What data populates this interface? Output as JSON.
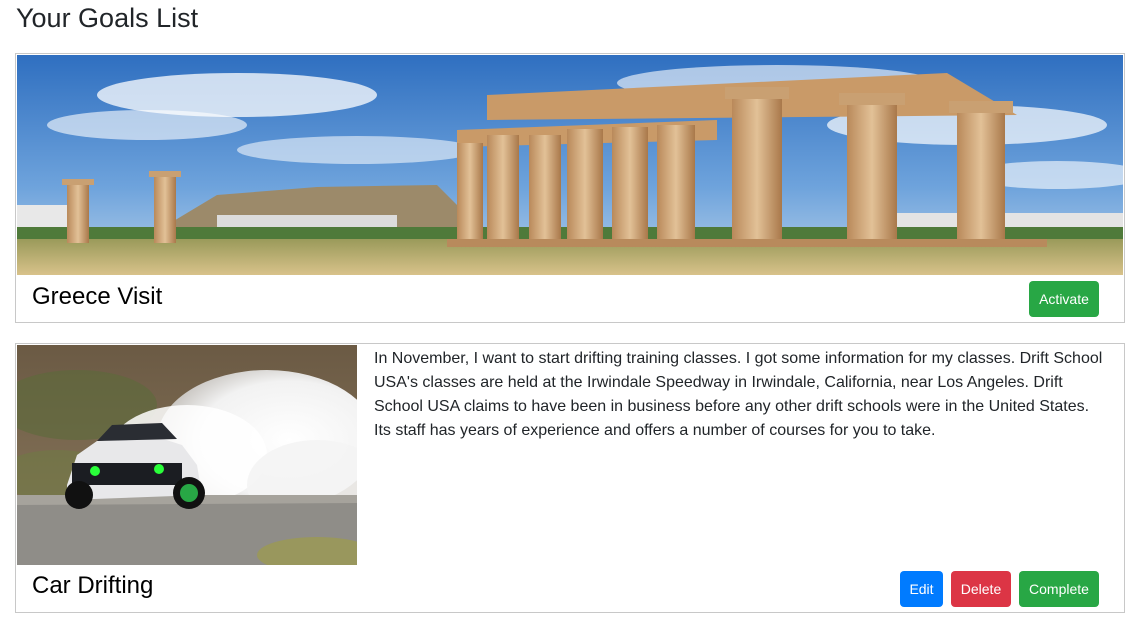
{
  "page": {
    "title": "Your Goals List"
  },
  "goals": [
    {
      "title": "Greece Visit",
      "image": "greece-temple-photo",
      "actions": {
        "activate": "Activate"
      }
    },
    {
      "title": "Car Drifting",
      "image": "drifting-car-photo",
      "description": "In November, I want to start drifting training classes. I got some information for my classes. Drift School USA's classes are held at the Irwindale Speedway in Irwindale, California, near Los Angeles. Drift School USA claims to have been in business before any other drift schools were in the United States. Its staff has years of experience and offers a number of courses for you to take.",
      "actions": {
        "edit": "Edit",
        "delete": "Delete",
        "complete": "Complete"
      }
    }
  ],
  "colors": {
    "success": "#28a745",
    "primary": "#007bff",
    "danger": "#dc3545",
    "card_border": "#c8c8c8"
  }
}
